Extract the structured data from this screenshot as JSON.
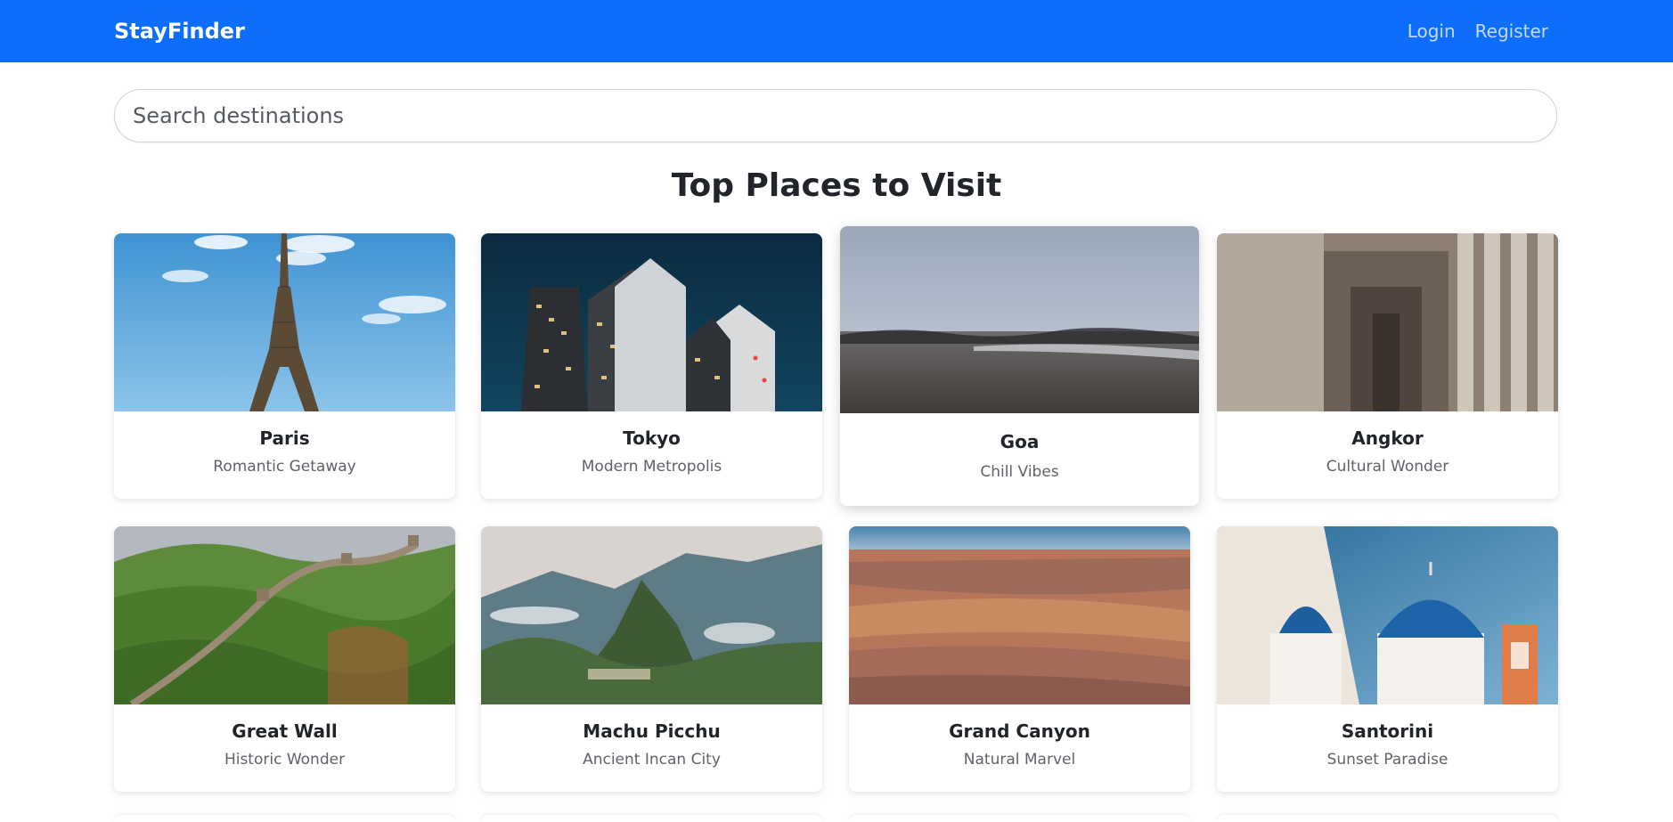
{
  "navbar": {
    "brand": "StayFinder",
    "links": [
      "Login",
      "Register"
    ]
  },
  "search": {
    "placeholder": "Search destinations",
    "value": ""
  },
  "main": {
    "title": "Top Places to Visit",
    "destinations": [
      {
        "name": "Paris",
        "tagline": "Romantic Getaway",
        "image": "eiffel-tower-photo"
      },
      {
        "name": "Tokyo",
        "tagline": "Modern Metropolis",
        "image": "skyscrapers-night-photo"
      },
      {
        "name": "Goa",
        "tagline": "Chill Vibes",
        "image": "beach-photo"
      },
      {
        "name": "Angkor",
        "tagline": "Cultural Wonder",
        "image": "temple-corridor-photo"
      },
      {
        "name": "Great Wall",
        "tagline": "Historic Wonder",
        "image": "great-wall-photo"
      },
      {
        "name": "Machu Picchu",
        "tagline": "Ancient Incan City",
        "image": "mountain-ruins-photo"
      },
      {
        "name": "Grand Canyon",
        "tagline": "Natural Marvel",
        "image": "canyon-photo"
      },
      {
        "name": "Santorini",
        "tagline": "Sunset Paradise",
        "image": "blue-dome-church-photo"
      }
    ]
  },
  "colors": {
    "navbar": "#0d6efd",
    "text": "#212529",
    "muted": "#5f6368"
  }
}
